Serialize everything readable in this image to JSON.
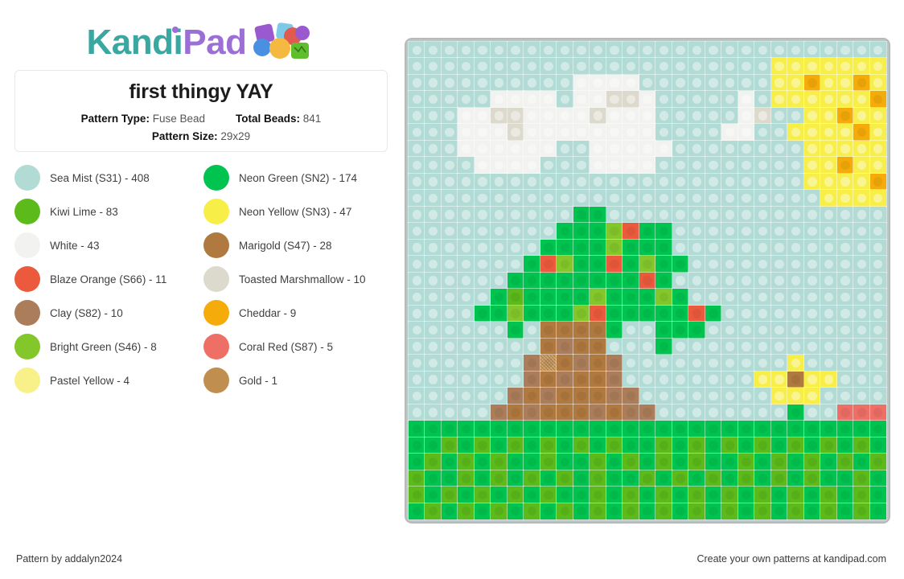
{
  "brand": {
    "name_part1": "Kandi",
    "name_part2": "Pad",
    "logo_icon": "bead-cluster-icon"
  },
  "info_card": {
    "title": "first thingy YAY",
    "pattern_type_label": "Pattern Type:",
    "pattern_type_value": "Fuse Bead",
    "total_beads_label": "Total Beads:",
    "total_beads_value": "841",
    "pattern_size_label": "Pattern Size:",
    "pattern_size_value": "29x29"
  },
  "legend": {
    "items": [
      {
        "name": "Sea Mist (S31) - 408",
        "color": "#b2dbd5",
        "key": "M",
        "textured": true
      },
      {
        "name": "Neon Green (SN2) - 174",
        "color": "#00c44f",
        "key": "N",
        "textured": false
      },
      {
        "name": "Kiwi Lime - 83",
        "color": "#5cba1a",
        "key": "K",
        "textured": false
      },
      {
        "name": "Neon Yellow (SN3) - 47",
        "color": "#f7ee48",
        "key": "Y",
        "textured": false
      },
      {
        "name": "White - 43",
        "color": "#f2f2f0",
        "key": "W",
        "textured": true
      },
      {
        "name": "Marigold (S47) - 28",
        "color": "#b0793f",
        "key": "R",
        "textured": false
      },
      {
        "name": "Blaze Orange (S66) - 11",
        "color": "#ec5a3e",
        "key": "B",
        "textured": false
      },
      {
        "name": "Toasted Marshmallow - 10",
        "color": "#dcdacd",
        "key": "T",
        "textured": false
      },
      {
        "name": "Clay (S82) - 10",
        "color": "#ab7d5a",
        "key": "C",
        "textured": false
      },
      {
        "name": "Cheddar - 9",
        "color": "#f5ab09",
        "key": "D",
        "textured": false
      },
      {
        "name": "Bright Green (S46) - 8",
        "color": "#84c72b",
        "key": "G",
        "textured": false
      },
      {
        "name": "Coral Red (S87) - 5",
        "color": "#ee6f66",
        "key": "O",
        "textured": false
      },
      {
        "name": "Pastel Yellow - 4",
        "color": "#f8f18a",
        "key": "P",
        "textured": true
      },
      {
        "name": "Gold - 1",
        "color": "#c08f50",
        "key": "A",
        "textured": true
      }
    ]
  },
  "pattern": {
    "width": 29,
    "height": 29,
    "palette": {
      "M": "#b2dbd5",
      "N": "#00c44f",
      "K": "#5cba1a",
      "Y": "#f7ee48",
      "W": "#f2f2f0",
      "R": "#b0793f",
      "B": "#ec5a3e",
      "T": "#dcdacd",
      "C": "#ab7d5a",
      "D": "#f5ab09",
      "G": "#84c72b",
      "O": "#ee6f66",
      "P": "#f8f18a",
      "A": "#c08f50"
    },
    "light_keys": [
      "M",
      "W",
      "T",
      "Y",
      "P"
    ],
    "rows": [
      "MMMMMMMMMMMMMMMMMMMMMMMMMMMMM",
      "MMMMMMMMMMMMMMMMMMMMMMYYYYYYY",
      "MMMMMMMMMMWWWWMMMMMMMMYYDYYDYY",
      "MMMMMWWWWMWWTTWMMMMMWMYYYYYYDD",
      "MMMWWTTWWWWTWWWMMMMMWTMMYYDYYYY",
      "MMMWWWTWWWWWWWWMMMMWWMMYYYYDYYY",
      "MMMWWWWWWMMWWWWWMMMMMMMMYYYYYYY",
      "MMMMWWWWMMMWWWWMMMMMMMMMYYDYYYY",
      "MMMMMMMMMMMMMMMMMMMMMMMMYYYYDYY",
      "MMMMMMMMMMMMMMMMMMMMMMMMMYYYYYY",
      "MMMMMMMMMMNNMMMMMMMMMMMMMMMMM",
      "MMMMMMMMMNNNGBNNMMMMMMMMMMMMM",
      "MMMMMMMMNNNNGNNNMMMMMMMMMMMMM",
      "MMMMMMMNBGNNBNGNNMMMMMMMMMMMM",
      "MMMMMMNNNNNNNNBNMMMMMMMMMMMMM",
      "MMMMMNKNNNNGNNNGNMMMMMMMMMMMM",
      "MMMMNNGNNNGBNNNNNBNMMMMMMMMMM",
      "MMMMMMNMRRRRNMMNNNMMMMMMMMMMM",
      "MMMMMMMMRCRRMMMNMMMMMMMMMMMMM",
      "MMMMMMMCARCRCMMMMMMMMMMYMMMMM",
      "MMMMMMMCRCRRCMMMMMMMMYYRYYMMMM",
      "MMMMMMCRCRRRCCMMMMMMMMYYYMMMMM",
      "MMMMMCRCRRRCRCCMMMMMMMMNMMOOOM",
      "NNNNNNNNNNNNNNNNNNNNNNNNNNNNN",
      "NNKNKNKNKNKNKNNKNKNKNKNKNKNKN",
      "NKNKNKNNKNNKNKNKNKNNKNKNKNKNK",
      "KNNKNKNKNKNKNNKNKNKNKNKNKNNKN",
      "KNKNKNKNKNNKNKNKNKNKNKNKNKNKN",
      "NKNKNKNKNKNKNKNKNKNKNKNKNKNKN"
    ]
  },
  "footer": {
    "left": "Pattern by addalyn2024",
    "right": "Create your own patterns at kandipad.com"
  }
}
